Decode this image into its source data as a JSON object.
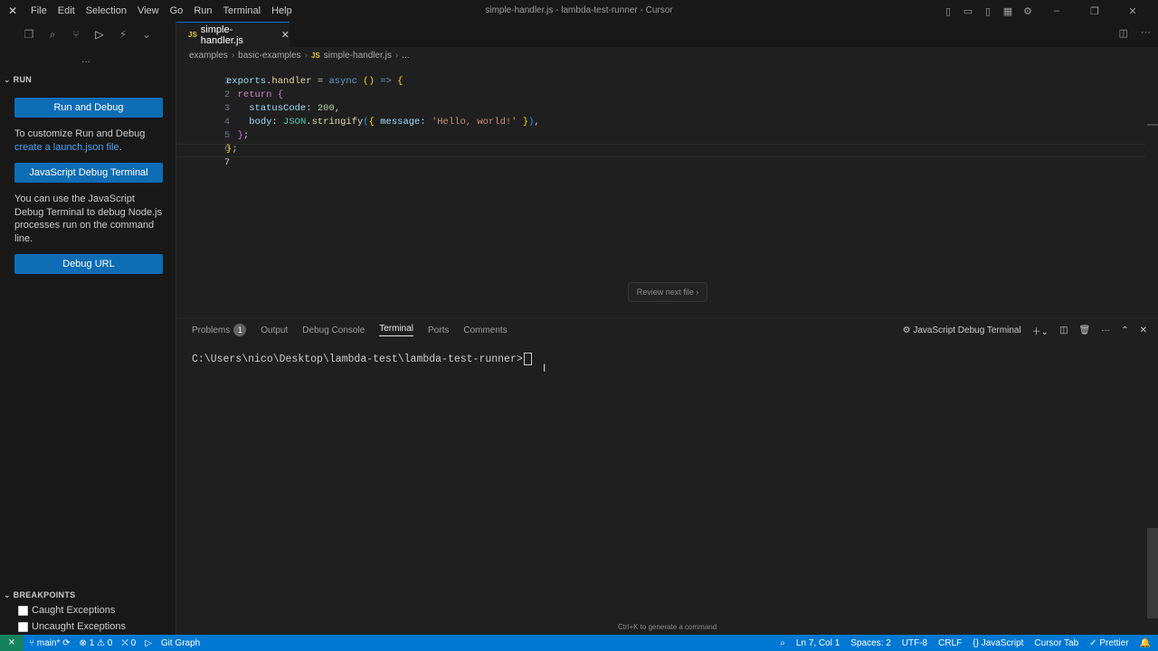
{
  "window": {
    "title": "simple-handler.js - lambda-test-runner - Cursor",
    "menu": [
      "File",
      "Edit",
      "Selection",
      "View",
      "Go",
      "Run",
      "Terminal",
      "Help"
    ]
  },
  "sidebar": {
    "section_title": "RUN",
    "run_debug_button": "Run and Debug",
    "customize_text": "To customize Run and Debug",
    "launch_link": "create a launch.json file",
    "launch_link_suffix": ".",
    "js_debug_terminal_button": "JavaScript Debug Terminal",
    "js_debug_description": "You can use the JavaScript Debug Terminal to debug Node.js processes run on the command line.",
    "debug_url_button": "Debug URL",
    "more": "...",
    "breakpoints": {
      "title": "BREAKPOINTS",
      "items": [
        {
          "label": "Caught Exceptions",
          "checked": false
        },
        {
          "label": "Uncaught Exceptions",
          "checked": false
        }
      ]
    }
  },
  "editor": {
    "tab": {
      "badge": "JS",
      "name": "simple-handler.js"
    },
    "breadcrumb": [
      "examples",
      "basic-examples",
      "simple-handler.js",
      "..."
    ],
    "line_numbers": [
      "1",
      "2",
      "3",
      "4",
      "5",
      "6",
      "7"
    ],
    "review_button": "Review next file"
  },
  "panel": {
    "tabs": [
      {
        "label": "Problems",
        "count": "1"
      },
      {
        "label": "Output"
      },
      {
        "label": "Debug Console"
      },
      {
        "label": "Terminal",
        "active": true
      },
      {
        "label": "Ports"
      },
      {
        "label": "Comments"
      }
    ],
    "terminal_name": "JavaScript Debug Terminal",
    "prompt": "C:\\Users\\nico\\Desktop\\lambda-test\\lambda-test-runner>",
    "hint": "Ctrl+K to generate a command"
  },
  "statusbar": {
    "branch": "main*",
    "errors": "1",
    "warnings": "0",
    "ports": "0",
    "git_graph": "Git Graph",
    "position": "Ln 7, Col 1",
    "spaces": "Spaces: 2",
    "encoding": "UTF-8",
    "eol": "CRLF",
    "language": "JavaScript",
    "cursor_tab": "Cursor Tab",
    "prettier": "Prettier"
  },
  "colors": {
    "accent": "#0078d4",
    "button": "#0e6cb5",
    "remote": "#16825d"
  }
}
